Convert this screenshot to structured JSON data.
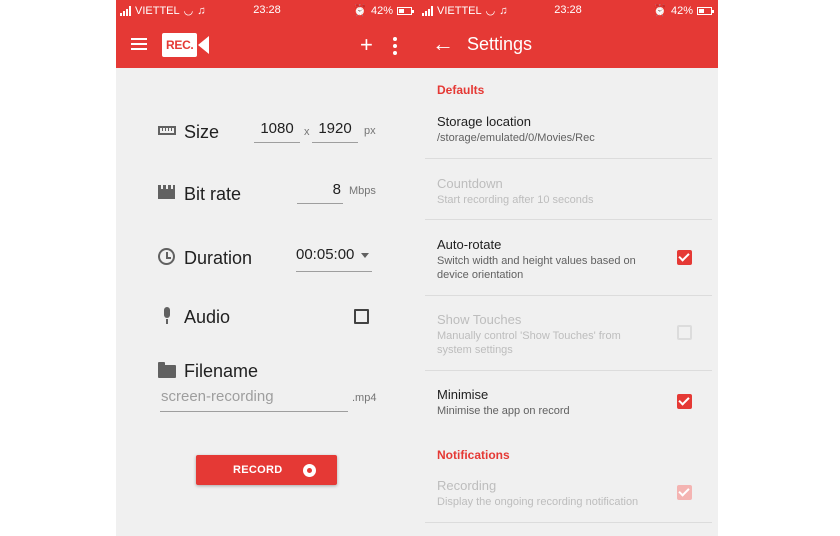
{
  "status_bar": {
    "carrier": "VIETTEL",
    "time": "23:28",
    "battery": "42%",
    "icons": [
      "signal-icon",
      "wifi-icon",
      "music-note-icon",
      "alarm-icon",
      "battery-icon"
    ]
  },
  "left": {
    "app_logo_text": "REC.",
    "size": {
      "label": "Size",
      "width": "1080",
      "times": "x",
      "height": "1920",
      "unit": "px"
    },
    "bitrate": {
      "label": "Bit rate",
      "value": "8",
      "unit": "Mbps"
    },
    "duration": {
      "label": "Duration",
      "value": "00:05:00"
    },
    "audio": {
      "label": "Audio",
      "checked": false
    },
    "filename": {
      "label": "Filename",
      "placeholder": "screen-recording",
      "ext": ".mp4"
    },
    "record_label": "RECORD"
  },
  "right": {
    "title": "Settings",
    "sections": {
      "defaults": "Defaults",
      "notifications": "Notifications"
    },
    "prefs": {
      "storage": {
        "title": "Storage location",
        "summary": "/storage/emulated/0/Movies/Rec"
      },
      "countdown": {
        "title": "Countdown",
        "summary": "Start recording after 10 seconds"
      },
      "autorotate": {
        "title": "Auto-rotate",
        "summary": "Switch width and height values based on device orientation",
        "checked": true
      },
      "touches": {
        "title": "Show Touches",
        "summary": "Manually control 'Show Touches' from system settings",
        "checked": false
      },
      "minimise": {
        "title": "Minimise",
        "summary": "Minimise the app on record",
        "checked": true
      },
      "recording": {
        "title": "Recording",
        "summary": "Display the ongoing recording notification",
        "checked": true
      }
    }
  },
  "colors": {
    "primary": "#e53935",
    "background": "#f0f0f0",
    "disabled_text": "#bdbdbd"
  }
}
